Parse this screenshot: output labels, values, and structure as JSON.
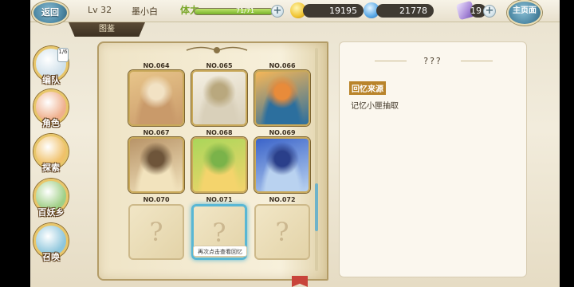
{
  "header": {
    "back_label": "返回",
    "level": "Lv 32",
    "player_name": "墨小白",
    "stamina_label": "体力",
    "stamina_text": "71/71",
    "stamina_fraction": 1.0,
    "gold": "19195",
    "gems": "21778",
    "crystals": "19",
    "main_label": "主页面"
  },
  "tab": {
    "label": "图鉴"
  },
  "nav": [
    {
      "label": "编队",
      "color": "#cfe0ea",
      "badge": "1/6"
    },
    {
      "label": "角色",
      "color": "#efb08d"
    },
    {
      "label": "探索",
      "color": "#f0c16a"
    },
    {
      "label": "百妖乡",
      "color": "#9fcf86"
    },
    {
      "label": "召唤",
      "color": "#8ec6dc"
    }
  ],
  "book": {
    "slots": [
      {
        "no": "NO.064",
        "filled": true,
        "colors": [
          "#e8c58a",
          "#c99a6a",
          "#f2e2c4"
        ]
      },
      {
        "no": "NO.065",
        "filled": true,
        "colors": [
          "#f4efe2",
          "#d9d0ba",
          "#b9a87e"
        ]
      },
      {
        "no": "NO.066",
        "filled": true,
        "colors": [
          "#f5b658",
          "#2c6f9e",
          "#e88b3a"
        ]
      },
      {
        "no": "NO.067",
        "filled": true,
        "colors": [
          "#b89468",
          "#f2e3bd",
          "#6e553a"
        ]
      },
      {
        "no": "NO.068",
        "filled": true,
        "colors": [
          "#a9d65a",
          "#f4d46c",
          "#7ab34a"
        ]
      },
      {
        "no": "NO.069",
        "filled": true,
        "colors": [
          "#3a63c9",
          "#b9d2f0",
          "#2a3f8a"
        ]
      },
      {
        "no": "NO.070",
        "filled": false
      },
      {
        "no": "NO.071",
        "filled": false,
        "selected": true
      },
      {
        "no": "NO.072",
        "filled": false
      }
    ],
    "hint": "再次点击查看回忆",
    "empty_mark": "?"
  },
  "info": {
    "title": "???",
    "source_label": "回忆来源",
    "source_text": "记忆小匣抽取"
  }
}
